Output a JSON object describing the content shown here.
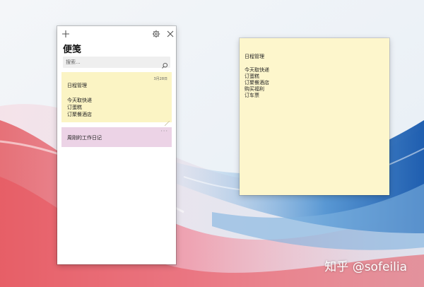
{
  "app": {
    "title": "便笺",
    "add_icon": "plus-icon",
    "settings_icon": "gear-icon",
    "close_icon": "close-icon"
  },
  "search": {
    "placeholder": "搜索...",
    "icon": "search-icon"
  },
  "notes": [
    {
      "color": "#fbf4c4",
      "date": "3月28日",
      "title": "日程管理",
      "lines": [
        "今天取快递",
        "订蛋糕",
        "订聚餐酒店"
      ]
    },
    {
      "color": "#ecd3e6",
      "title": "周刚的工作日记",
      "more": "···"
    }
  ],
  "open_note": {
    "color": "#fdf6cc",
    "title": "日程管理",
    "lines": [
      "今天取快递",
      "订蛋糕",
      "订聚餐酒店",
      "购买福利",
      "订车票"
    ]
  },
  "watermark": "知乎 @sofeilia"
}
